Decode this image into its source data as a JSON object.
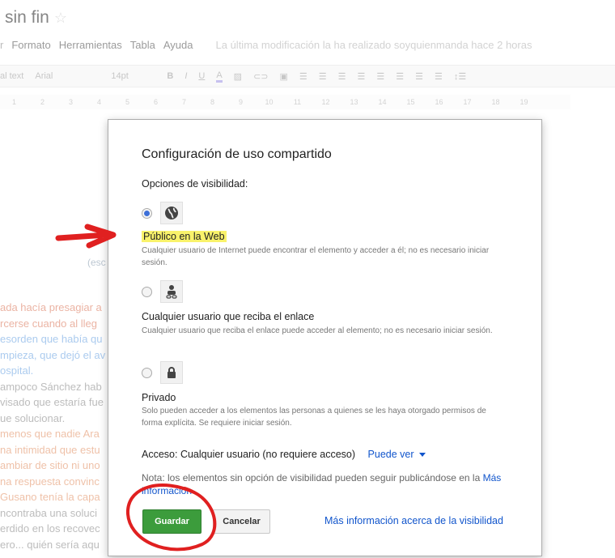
{
  "doc": {
    "title": "sin fin",
    "menu": [
      "Formato",
      "Herramientas",
      "Tabla",
      "Ayuda"
    ],
    "last_modified": "La última modificación la ha realizado soyquienmanda hace 2 horas",
    "toolbar": [
      "al text",
      "Arial",
      "14pt",
      "B",
      "I",
      "U",
      "A"
    ],
    "ruler": [
      "1",
      "2",
      "3",
      "4",
      "5",
      "6",
      "7",
      "8",
      "9",
      "10",
      "11",
      "12",
      "13",
      "14",
      "15",
      "16",
      "17",
      "18",
      "19"
    ],
    "escribe": "(esc",
    "body_lines": [
      {
        "text": "ada hacía presagiar a",
        "color": "#e08b72"
      },
      {
        "text": "rcerse cuando al lleg",
        "color": "#e08b72"
      },
      {
        "text": "esorden que había qu",
        "color": "#7fb0e6"
      },
      {
        "text": "mpieza, que dejó el av",
        "color": "#7fb0e6"
      },
      {
        "text": "ospital.",
        "color": "#7fb0e6"
      },
      {
        "text": "ampoco Sánchez hab",
        "color": "#999999"
      },
      {
        "text": "visado que estaría fue",
        "color": "#999999"
      },
      {
        "text": "ue solucionar.",
        "color": "#999999"
      },
      {
        "text": "menos que nadie Ara",
        "color": "#e6a07a"
      },
      {
        "text": "na intimidad que estu",
        "color": "#e6a07a"
      },
      {
        "text": "ambiar de sitio ni uno",
        "color": "#e6a07a"
      },
      {
        "text": "na respuesta convinc",
        "color": "#e6a07a"
      },
      {
        "text": "Gusano tenía la capa",
        "color": "#e6a07a"
      },
      {
        "text": "ncontraba una soluci",
        "color": "#999999"
      },
      {
        "text": "erdido en los recovec",
        "color": "#999999"
      },
      {
        "text": "ero... quién sería aqu",
        "color": "#999999"
      }
    ]
  },
  "dialog": {
    "title": "Configuración de uso compartido",
    "visibility_label": "Opciones de visibilidad:",
    "options": [
      {
        "label": "Público en la Web",
        "desc": "Cualquier usuario de Internet puede encontrar el elemento y acceder a él; no es necesario iniciar sesión.",
        "icon": "globe-icon",
        "checked": true
      },
      {
        "label": "Cualquier usuario que reciba el enlace",
        "desc": "Cualquier usuario que reciba el enlace puede acceder al elemento; no es necesario iniciar sesión.",
        "icon": "person-link-icon",
        "checked": false
      },
      {
        "label": "Privado",
        "desc": "Solo pueden acceder a los elementos las personas a quienes se les haya otorgado permisos de forma explícita. Se requiere iniciar sesión.",
        "icon": "lock-icon",
        "checked": false
      }
    ],
    "access_label": "Acceso:",
    "access_value": "Cualquier usuario (no requiere acceso)",
    "permission": "Puede ver",
    "note": "Nota: los elementos sin opción de visibilidad pueden seguir publicándose en la",
    "note_link": "Más información",
    "save": "Guardar",
    "cancel": "Cancelar",
    "more_info": "Más información acerca de la visibilidad"
  },
  "colors": {
    "accent_link": "#1155cc",
    "save_green": "#3c9c3c",
    "highlight": "#f9f26b",
    "annotation_red": "#e02020"
  }
}
